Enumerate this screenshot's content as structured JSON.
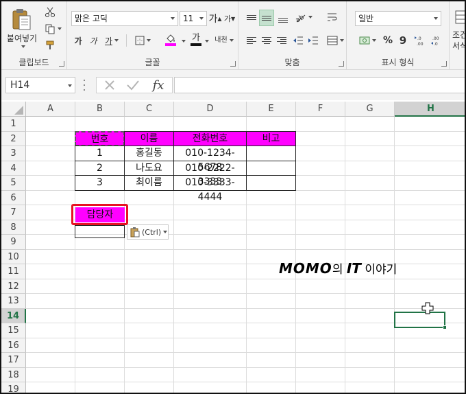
{
  "clipboard": {
    "paste_label": "붙여넣기",
    "group_label": "클립보드"
  },
  "font": {
    "name": "맑은 고딕",
    "size": "11",
    "grow": "가",
    "shrink": "가",
    "bold": "가",
    "italic": "가",
    "underline": "가",
    "font_color_glyph": "가",
    "phonetic": "내천",
    "group_label": "글꼴"
  },
  "alignment": {
    "group_label": "맞춤"
  },
  "number": {
    "format": "일반",
    "percent": "%",
    "comma": "9",
    "group_label": "표시 형식"
  },
  "styles": {
    "partial_label_1": "조건",
    "partial_label_2": "서식"
  },
  "formula_bar": {
    "name_box": "H14",
    "fx": "fx",
    "formula": ""
  },
  "columns": [
    "A",
    "B",
    "C",
    "D",
    "E",
    "F",
    "G",
    "H"
  ],
  "rows": [
    "1",
    "2",
    "3",
    "4",
    "5",
    "6",
    "7",
    "8",
    "9",
    "10",
    "11",
    "12",
    "13",
    "14",
    "15",
    "16",
    "17",
    "18",
    "19"
  ],
  "active_cell": {
    "column": "H",
    "row": "14"
  },
  "table": {
    "headers": [
      "번호",
      "이름",
      "전화번호",
      "비고"
    ],
    "rows": [
      [
        "1",
        "홍길동",
        "010-1234-5678",
        ""
      ],
      [
        "2",
        "나도요",
        "010-2222-3333",
        ""
      ],
      [
        "3",
        "최이름",
        "010-3333-4444",
        ""
      ]
    ]
  },
  "pasted_cell": {
    "text": "담당자"
  },
  "paste_options": {
    "label": "(Ctrl)"
  },
  "watermark": {
    "brand": "MOMO",
    "part1": "의 ",
    "it": "IT",
    "part2": " 이야기"
  },
  "colors": {
    "header_fill": "#ff00ff",
    "highlight_border": "#e81123",
    "accent": "#217346"
  }
}
